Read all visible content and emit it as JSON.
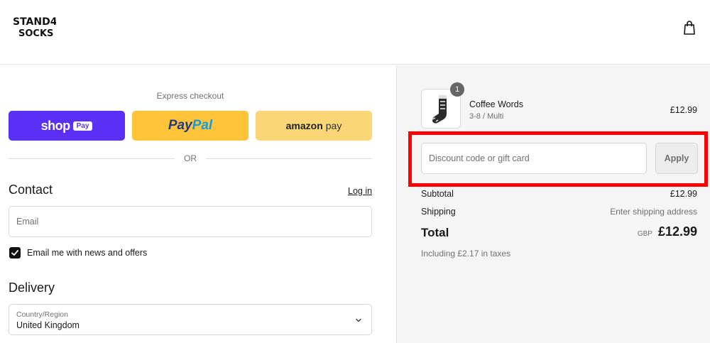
{
  "header": {
    "logo_text_top": "STAND4",
    "logo_text_bottom": "SOCKS",
    "cart_icon": "shopping-bag-icon"
  },
  "express": {
    "label": "Express checkout",
    "shop_label": "shop",
    "shop_badge": "Pay",
    "paypal_part1": "Pay",
    "paypal_part2": "Pal",
    "amazon_part1": "amazon",
    "amazon_part2": "pay",
    "divider": "OR"
  },
  "contact": {
    "heading": "Contact",
    "login_link": "Log in",
    "email_placeholder": "Email",
    "newsletter_label": "Email me with news and offers",
    "newsletter_checked": true
  },
  "delivery": {
    "heading": "Delivery",
    "country_label": "Country/Region",
    "country_value": "United Kingdom"
  },
  "summary": {
    "item": {
      "name": "Coffee Words",
      "variant": "3-8 / Multi",
      "price": "£12.99",
      "quantity": "1"
    },
    "discount_placeholder": "Discount code or gift card",
    "apply_label": "Apply",
    "subtotal_label": "Subtotal",
    "subtotal_value": "£12.99",
    "shipping_label": "Shipping",
    "shipping_value": "Enter shipping address",
    "total_label": "Total",
    "total_currency": "GBP",
    "total_value": "£12.99",
    "taxes_note": "Including £2.17 in taxes"
  },
  "colors": {
    "shop_pay": "#5a31f4",
    "paypal": "#ffc439",
    "amazon_pay": "#fad676",
    "highlight": "#ff0000",
    "summary_bg": "#f5f5f5"
  }
}
